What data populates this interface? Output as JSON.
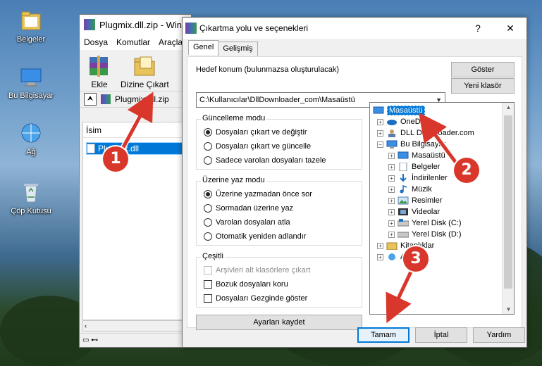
{
  "desktop": {
    "icons": [
      {
        "label": "Belgeler",
        "icon": "folder-icon"
      },
      {
        "label": "Bu Bilgisayar",
        "icon": "computer-icon"
      },
      {
        "label": "Ağ",
        "icon": "network-icon"
      },
      {
        "label": "Çöp Kutusu",
        "icon": "recycle-bin-icon"
      }
    ]
  },
  "winrar": {
    "title": "Plugmix.dll.zip - Win",
    "menu": [
      "Dosya",
      "Komutlar",
      "Araçla"
    ],
    "toolbar": {
      "add_label": "Ekle",
      "extract_label": "Dizine Çıkart"
    },
    "path": "Plugmix.dll.zip",
    "column_name": "İsim",
    "file": "Plugmix.dll"
  },
  "dialog": {
    "title": "Çıkartma yolu ve seçenekleri",
    "help_glyph": "?",
    "close_glyph": "✕",
    "tabs": [
      "Genel",
      "Gelişmiş"
    ],
    "target_label": "Hedef konum (bulunmazsa oluşturulacak)",
    "target_value": "C:\\Kullanıcılar\\DllDownloader_com\\Masaüstü",
    "show_button": "Göster",
    "new_folder_button": "Yeni klasör",
    "update_mode": {
      "title": "Güncelleme modu",
      "options": [
        "Dosyaları çıkart ve değiştir",
        "Dosyaları çıkart ve güncelle",
        "Sadece varolan dosyaları tazele"
      ],
      "selected": 0
    },
    "overwrite_mode": {
      "title": "Üzerine yaz modu",
      "options": [
        "Üzerine yazmadan önce sor",
        "Sormadan üzerine yaz",
        "Varolan dosyaları atla",
        "Otomatik yeniden adlandır"
      ],
      "selected": 0
    },
    "misc": {
      "title": "Çeşitli",
      "options": [
        {
          "label": "Arşivleri alt klasörlere çıkart",
          "checked": false,
          "disabled": true
        },
        {
          "label": "Bozuk dosyaları koru",
          "checked": false,
          "disabled": false
        },
        {
          "label": "Dosyaları Gezginde göster",
          "checked": false,
          "disabled": false
        }
      ]
    },
    "save_settings_button": "Ayarları kaydet",
    "tree": [
      {
        "label": "Masaüstü",
        "icon": "desktop-icon",
        "selected": true,
        "expander": ""
      },
      {
        "label": "OneDrive",
        "icon": "cloud-icon",
        "selected": false,
        "expander": "+"
      },
      {
        "label": "DLL Downloader.com",
        "icon": "user-icon",
        "selected": false,
        "expander": "+"
      },
      {
        "label": "Bu Bilgisayar",
        "icon": "computer-icon",
        "selected": false,
        "expander": "−"
      },
      {
        "label": "Masaüstü",
        "icon": "desktop-icon",
        "selected": false,
        "expander": "+"
      },
      {
        "label": "Belgeler",
        "icon": "document-icon",
        "selected": false,
        "expander": "+"
      },
      {
        "label": "İndirilenler",
        "icon": "download-icon",
        "selected": false,
        "expander": "+"
      },
      {
        "label": "Müzik",
        "icon": "music-icon",
        "selected": false,
        "expander": "+"
      },
      {
        "label": "Resimler",
        "icon": "picture-icon",
        "selected": false,
        "expander": "+"
      },
      {
        "label": "Videolar",
        "icon": "video-icon",
        "selected": false,
        "expander": "+"
      },
      {
        "label": "Yerel Disk (C:)",
        "icon": "drive-icon",
        "selected": false,
        "expander": "+"
      },
      {
        "label": "Yerel Disk (D:)",
        "icon": "drive-icon",
        "selected": false,
        "expander": "+"
      },
      {
        "label": "Kitaplıklar",
        "icon": "library-icon",
        "selected": false,
        "expander": "+"
      },
      {
        "label": "Ağ",
        "icon": "network-icon",
        "selected": false,
        "expander": "+"
      }
    ],
    "ok_button": "Tamam",
    "cancel_button": "İptal",
    "help_button": "Yardım"
  },
  "annotations": [
    "1",
    "2",
    "3"
  ],
  "colors": {
    "accent": "#0078d7",
    "annotation": "#d9372b"
  }
}
